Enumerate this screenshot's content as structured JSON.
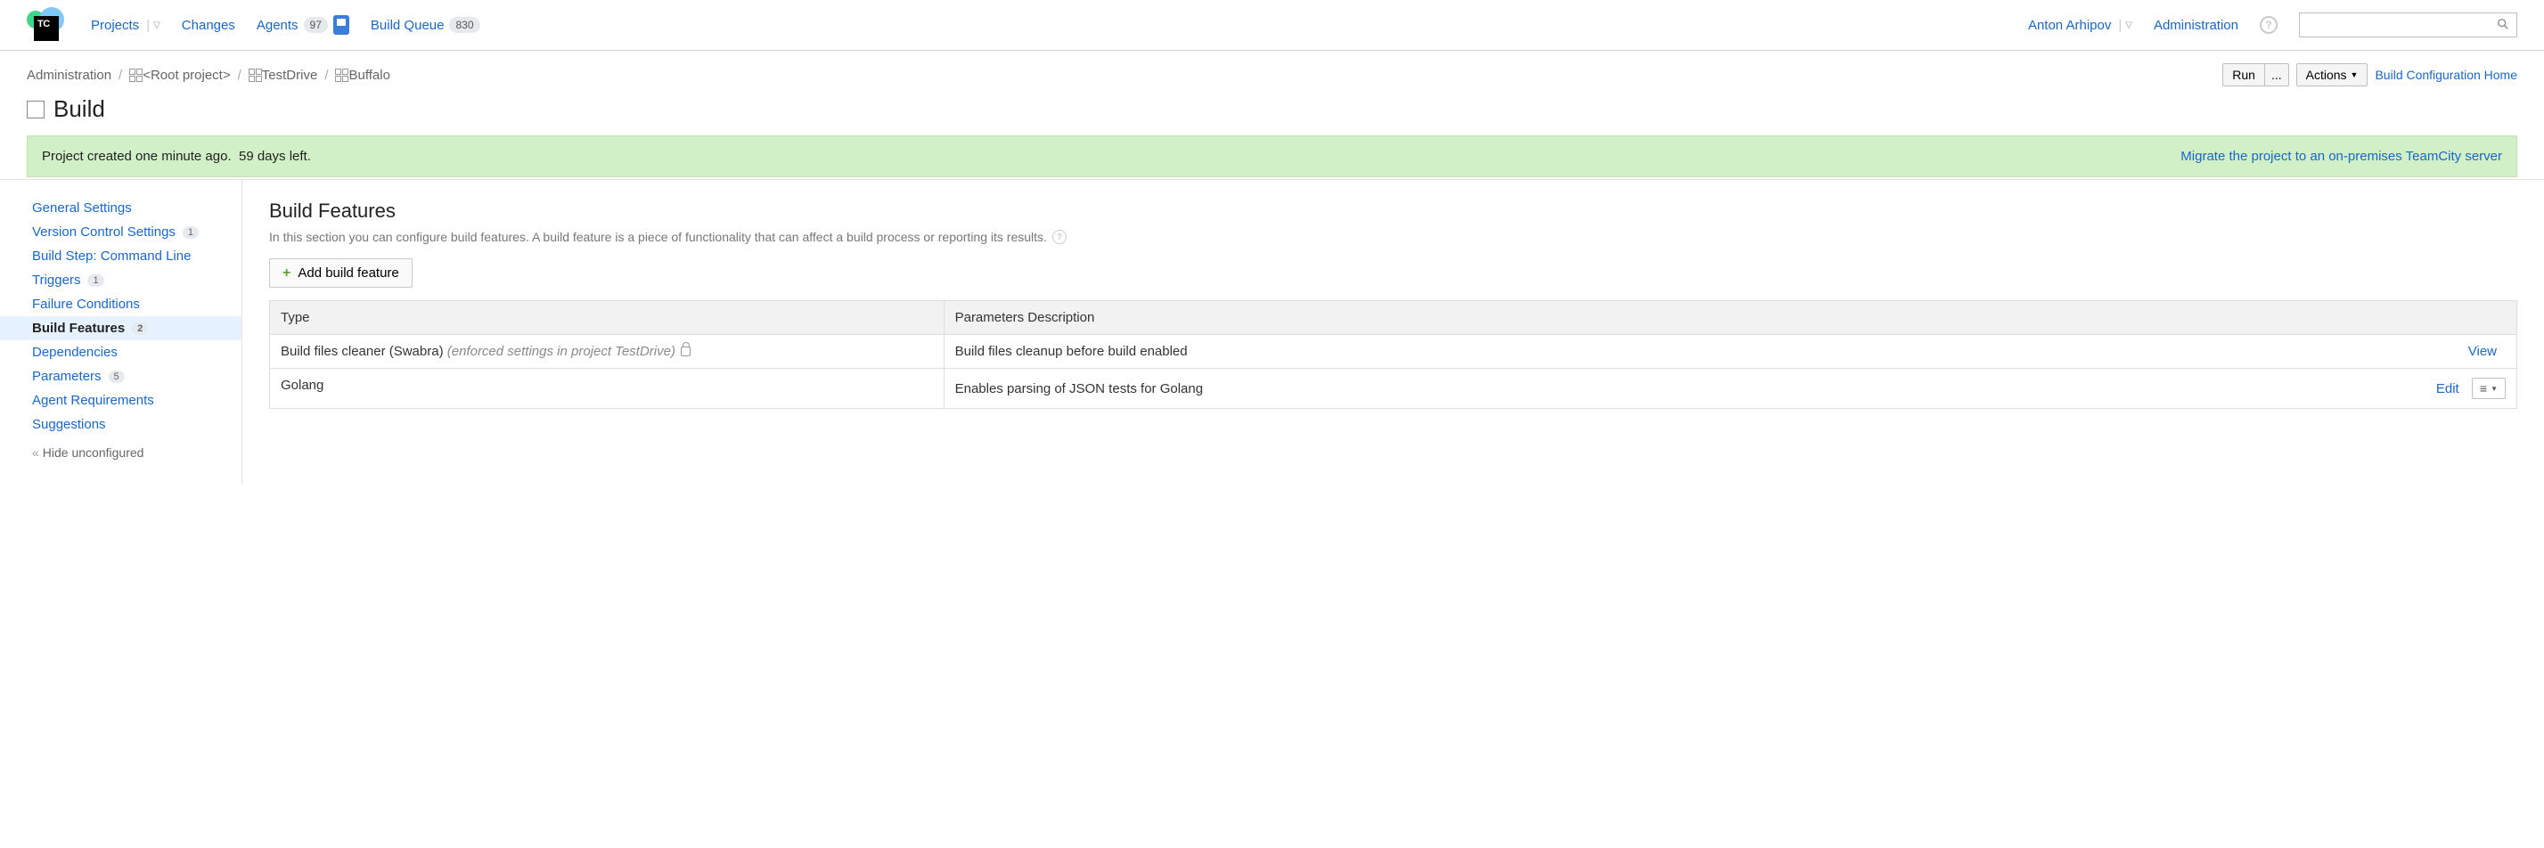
{
  "nav": {
    "projects": "Projects",
    "changes": "Changes",
    "agents": "Agents",
    "agents_count": "97",
    "build_queue": "Build Queue",
    "queue_count": "830"
  },
  "user": {
    "name": "Anton Arhipov",
    "admin": "Administration"
  },
  "breadcrumbs": {
    "administration": "Administration",
    "root_project": "<Root project>",
    "project": "TestDrive",
    "config": "Buffalo"
  },
  "actions": {
    "run": "Run",
    "run_dots": "...",
    "actions": "Actions",
    "home": "Build Configuration Home"
  },
  "title": "Build",
  "banner": {
    "msg_a": "Project created one minute ago.",
    "msg_b": "59 days left.",
    "link": "Migrate the project to an on-premises TeamCity server"
  },
  "sidebar": {
    "general": "General Settings",
    "vcs": "Version Control Settings",
    "vcs_badge": "1",
    "build_step": "Build Step: Command Line",
    "triggers": "Triggers",
    "triggers_badge": "1",
    "failure": "Failure Conditions",
    "features": "Build Features",
    "features_badge": "2",
    "dependencies": "Dependencies",
    "parameters": "Parameters",
    "parameters_badge": "5",
    "agent_req": "Agent Requirements",
    "suggestions": "Suggestions",
    "hide": "Hide unconfigured"
  },
  "content": {
    "section_title": "Build Features",
    "section_desc": "In this section you can configure build features. A build feature is a piece of functionality that can affect a build process or reporting its results.",
    "add_button": "Add build feature",
    "col_type": "Type",
    "col_params": "Parameters Description",
    "rows": [
      {
        "type": "Build files cleaner (Swabra)",
        "enforced": "(enforced settings in project TestDrive)",
        "locked": true,
        "desc": "Build files cleanup before build enabled",
        "action": "View",
        "editable": false
      },
      {
        "type": "Golang",
        "enforced": "",
        "locked": false,
        "desc": "Enables parsing of JSON tests for Golang",
        "action": "Edit",
        "editable": true
      }
    ]
  }
}
